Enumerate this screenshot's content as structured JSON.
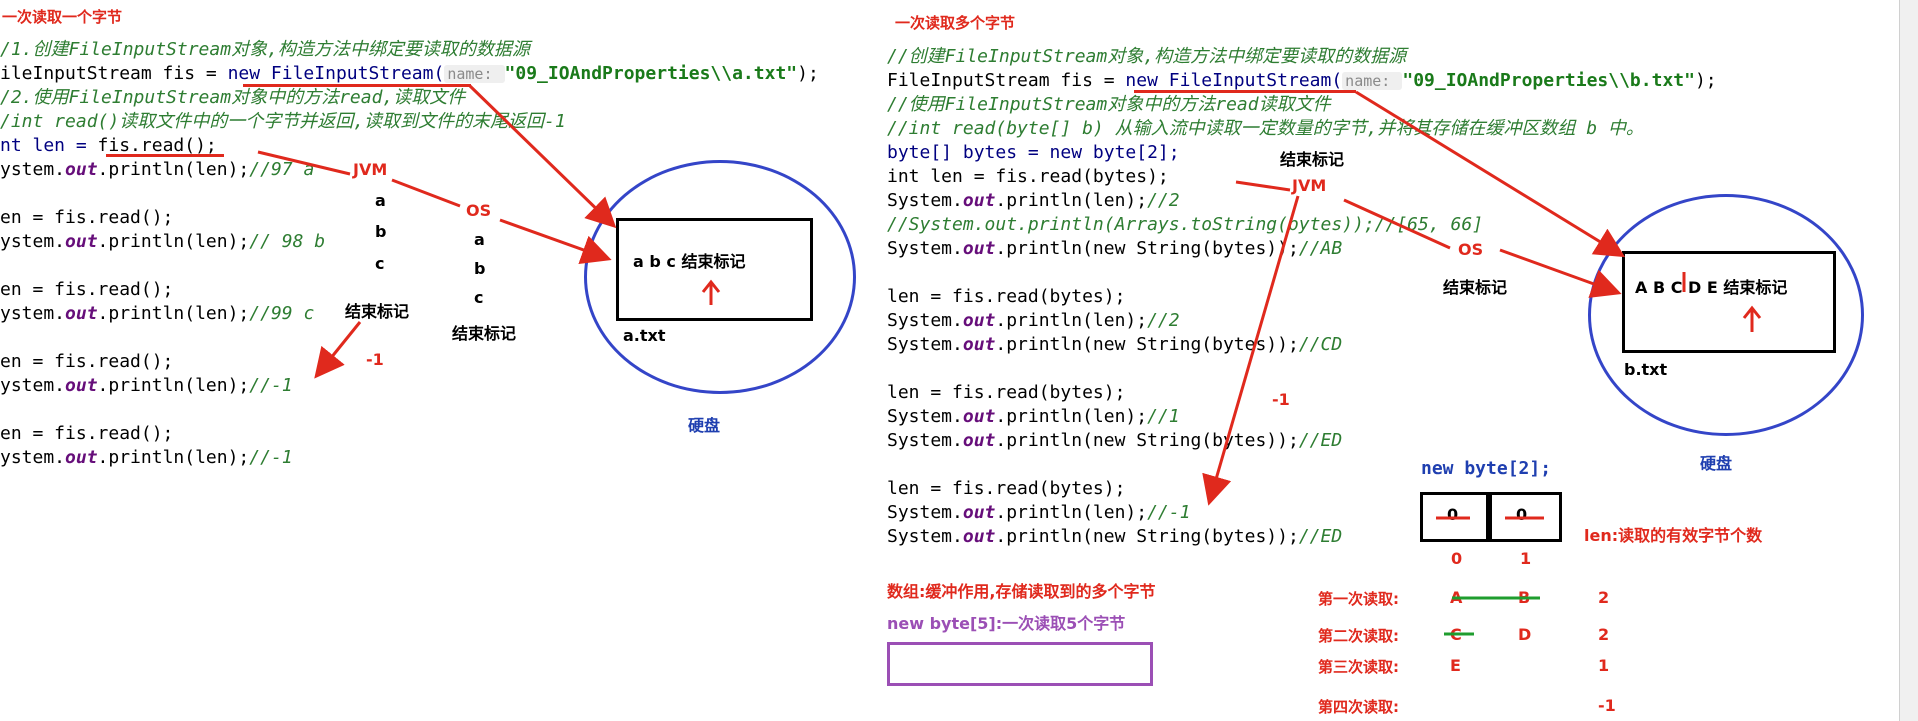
{
  "left": {
    "title": "一次读取一个字节",
    "code": [
      "/1.创建FileInputStream对象,构造方法中绑定要读取的数据源",
      "ileInputStream fis = ",
      "new FileInputStream(",
      "name: ",
      "\"09_IOAndProperties\\\\a.txt\"",
      ");",
      "/2.使用FileInputStream对象中的方法read,读取文件",
      "/int read()读取文件中的一个字节并返回,读取到文件的末尾返回-1",
      "nt len = ",
      "fis.read();",
      "ystem.",
      "out",
      ".println(len);",
      "//97 a",
      "en = fis.read();",
      "// 98 b",
      "//99 c",
      "//-1"
    ],
    "jvm_label": "JVM",
    "jvm_chars": [
      "a",
      "b",
      "c"
    ],
    "jvm_end": "结束标记",
    "os_label": "OS",
    "os_chars": [
      "a",
      "b",
      "c"
    ],
    "os_end": "结束标记",
    "minus_one": "-1",
    "file_content": "a b c 结束标记",
    "file_name": "a.txt",
    "disk_label": "硬盘"
  },
  "right": {
    "title": "一次读取多个字节",
    "code": {
      "c1": "//创建FileInputStream对象,构造方法中绑定要读取的数据源",
      "c2a": "FileInputStream fis = ",
      "c2b": "new FileInputStream(",
      "c2hint": "name: ",
      "c2str": "\"09_IOAndProperties\\\\b.txt\"",
      "c2end": ");",
      "c3": "//使用FileInputStream对象中的方法read读取文件",
      "c4": "//int read(byte[] b) 从输入流中读取一定数量的字节,并将其存储在缓冲区数组 b 中。",
      "c5": "byte[] bytes = new byte[2];",
      "c6": "int len = fis.read(bytes);",
      "c7a": "System.",
      "c7b": "out",
      "c7c": ".println(len);",
      "c7d": "//2",
      "c8": "//System.out.println(Arrays.toString(bytes));//[65, 66]",
      "c9a": ".println(new String(bytes));",
      "c9b": "//AB",
      "c10": "len = fis.read(bytes);",
      "c12b": "//CD",
      "c14b": "//1",
      "c15b": "//ED",
      "c17b": "//-1",
      "c18b": "//ED"
    },
    "jvm_end_top": "结束标记",
    "jvm_label": "JVM",
    "os_label": "OS",
    "os_end": "结束标记",
    "minus_one": "-1",
    "file_content": "A B C D E 结束标记",
    "file_name": "b.txt",
    "disk_label": "硬盘",
    "array_decl": "new byte[2];",
    "array_cells": [
      "0",
      "0"
    ],
    "array_indices": [
      "0",
      "1"
    ],
    "len_note": "len:读取的有效字节个数",
    "array_note": "数组:缓冲作用,存储读取到的多个字节",
    "byte5_note": "new byte[5]:一次读取5个字节",
    "reads": [
      {
        "label": "第一次读取:",
        "a": "A",
        "b": "B",
        "n": "2"
      },
      {
        "label": "第二次读取:",
        "a": "C",
        "b": "D",
        "n": "2"
      },
      {
        "label": "第三次读取:",
        "a": "E",
        "b": "",
        "n": "1"
      },
      {
        "label": "第四次读取:",
        "a": "",
        "b": "",
        "n": "-1"
      }
    ]
  },
  "colors": {
    "annotation": "#e0291d",
    "disk_circle": "#3445c8",
    "comment": "#2e7d32",
    "keyword": "#000080",
    "purple_note": "#9b4fb5"
  }
}
